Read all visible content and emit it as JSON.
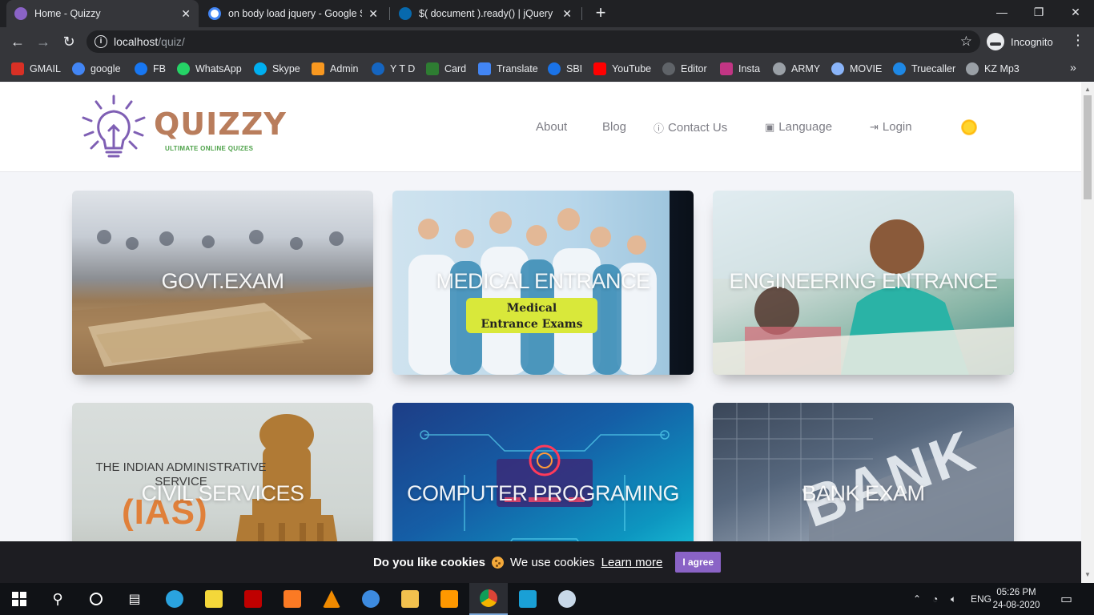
{
  "browser": {
    "tabs": [
      {
        "title": "Home - Quizzy",
        "active": true,
        "favicon_color": "#8a63c6"
      },
      {
        "title": "on body load jquery - Google Se",
        "active": false,
        "favicon_color": "#4285f4"
      },
      {
        "title": "$( document ).ready() | jQuery Le",
        "active": false,
        "favicon_color": "#0769ad"
      }
    ],
    "new_tab": "+",
    "url_host": "localhost",
    "url_path": "/quiz/",
    "profile": "Incognito",
    "bookmarks": [
      {
        "label": "GMAIL",
        "color": "#d93025"
      },
      {
        "label": "google",
        "color": "#4285f4"
      },
      {
        "label": "FB",
        "color": "#1877f2"
      },
      {
        "label": "WhatsApp",
        "color": "#25d366"
      },
      {
        "label": "Skype",
        "color": "#00aff0"
      },
      {
        "label": "Admin",
        "color": "#f89820"
      },
      {
        "label": "Y T D",
        "color": "#1565c0"
      },
      {
        "label": "Card",
        "color": "#2e7d32"
      },
      {
        "label": "Translate",
        "color": "#4285f4"
      },
      {
        "label": "SBI",
        "color": "#1a73e8"
      },
      {
        "label": "YouTube",
        "color": "#ff0000"
      },
      {
        "label": "Editor",
        "color": "#5f6368"
      },
      {
        "label": "Insta",
        "color": "#c13584"
      },
      {
        "label": "ARMY",
        "color": "#9aa0a6"
      },
      {
        "label": "MOVIE",
        "color": "#8ab4f8"
      },
      {
        "label": "Truecaller",
        "color": "#1e88e5"
      },
      {
        "label": "KZ Mp3",
        "color": "#9aa0a6"
      }
    ]
  },
  "site": {
    "logo_text": "QUIZZY",
    "logo_tagline": "ULTIMATE ONLINE QUIZES",
    "nav": {
      "about": "About",
      "blog": "Blog",
      "contact": "Contact Us",
      "language": "Language",
      "login": "Login"
    },
    "categories": [
      {
        "title": "GOVT.EXAM"
      },
      {
        "title": "MEDICAL ENTRANCE",
        "badge_line1": "Medical",
        "badge_line2": "Entrance Exams"
      },
      {
        "title": "ENGINEERING ENTRANCE"
      },
      {
        "title": "CIVIL SERVICES",
        "overlay_line1": "THE INDIAN ADMINISTRATIVE",
        "overlay_line2": "SERVICE",
        "overlay_big": "(IAS)"
      },
      {
        "title": "COMPUTER PROGRAMING"
      },
      {
        "title": "BANK EXAM",
        "overlay_big": "BANK"
      }
    ],
    "cookie_bar": {
      "question": "Do you like cookies",
      "message": "We use cookies",
      "learn_more": "Learn more",
      "agree": "I agree"
    }
  },
  "taskbar": {
    "language": "ENG",
    "time": "05:26 PM",
    "date": "24-08-2020"
  }
}
